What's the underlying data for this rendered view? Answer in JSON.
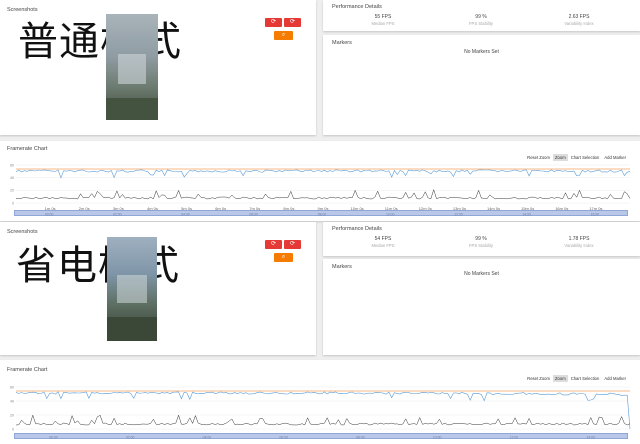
{
  "colors": {
    "fps_line": "#5b9bd5",
    "target_line": "#f5a35c",
    "frametime_line": "#333333",
    "navigator": "#b9c8e8",
    "red_button": "#e53935",
    "orange_button": "#f57c00"
  },
  "panels": [
    {
      "mode_label": "普通模式",
      "screenshots_title": "Screenshots",
      "perf_title": "Performance Details",
      "metrics": [
        {
          "value": "55 FPS",
          "label": "Median FPS"
        },
        {
          "value": "99 %",
          "label": "FPS Stability"
        },
        {
          "value": "2.63 FPS",
          "label": "Variability Index"
        }
      ],
      "markers_title": "Markers",
      "no_markers": "No Markers Set",
      "chart_title": "Framerate Chart",
      "toolbar": [
        "Reset Zoom",
        "Zoom",
        "Chart Selection",
        "Add Marker"
      ],
      "y_ticks": [
        "60",
        "40",
        "20",
        "0"
      ],
      "x_ticks": [
        "1m 0s",
        "2m 0s",
        "3m 0s",
        "4m 0s",
        "5m 0s",
        "6m 0s",
        "7m 0s",
        "8m 0s",
        "9m 0s",
        "10m 0s",
        "11m 0s",
        "12m 0s",
        "13m 0s",
        "14m 0s",
        "15m 0s",
        "16m 0s",
        "17m 0s"
      ],
      "nav_ticks": [
        "00:00",
        "02:00",
        "04:00",
        "06:00",
        "08:00",
        "10:00",
        "12:00",
        "14:00",
        "16:00"
      ],
      "icons": [
        "refresh-icon",
        "refresh-icon",
        "zoom-icon"
      ]
    },
    {
      "mode_label": "省电模式",
      "screenshots_title": "Screenshots",
      "perf_title": "Performance Details",
      "metrics": [
        {
          "value": "54 FPS",
          "label": "Median FPS"
        },
        {
          "value": "99 %",
          "label": "FPS Stability"
        },
        {
          "value": "1.78 FPS",
          "label": "Variability Index"
        }
      ],
      "markers_title": "Markers",
      "no_markers": "No Markers Set",
      "chart_title": "Framerate Chart",
      "toolbar": [
        "Reset Zoom",
        "Zoom",
        "Chart Selection",
        "Add Marker"
      ],
      "y_ticks": [
        "60",
        "40",
        "20",
        "0"
      ],
      "x_ticks": [
        "1m 0s",
        "2m 0s",
        "3m 0s",
        "4m 0s",
        "5m 0s",
        "6m 0s",
        "7m 0s",
        "8m 0s",
        "9m 0s",
        "10m 0s",
        "11m 0s",
        "12m 0s",
        "13m 0s",
        "14m 0s",
        "15m 0s"
      ],
      "nav_ticks": [
        "00:00",
        "02:00",
        "04:00",
        "06:00",
        "08:00",
        "10:00",
        "12:00",
        "14:00"
      ],
      "icons": [
        "refresh-icon",
        "refresh-icon",
        "zoom-icon"
      ]
    }
  ]
}
